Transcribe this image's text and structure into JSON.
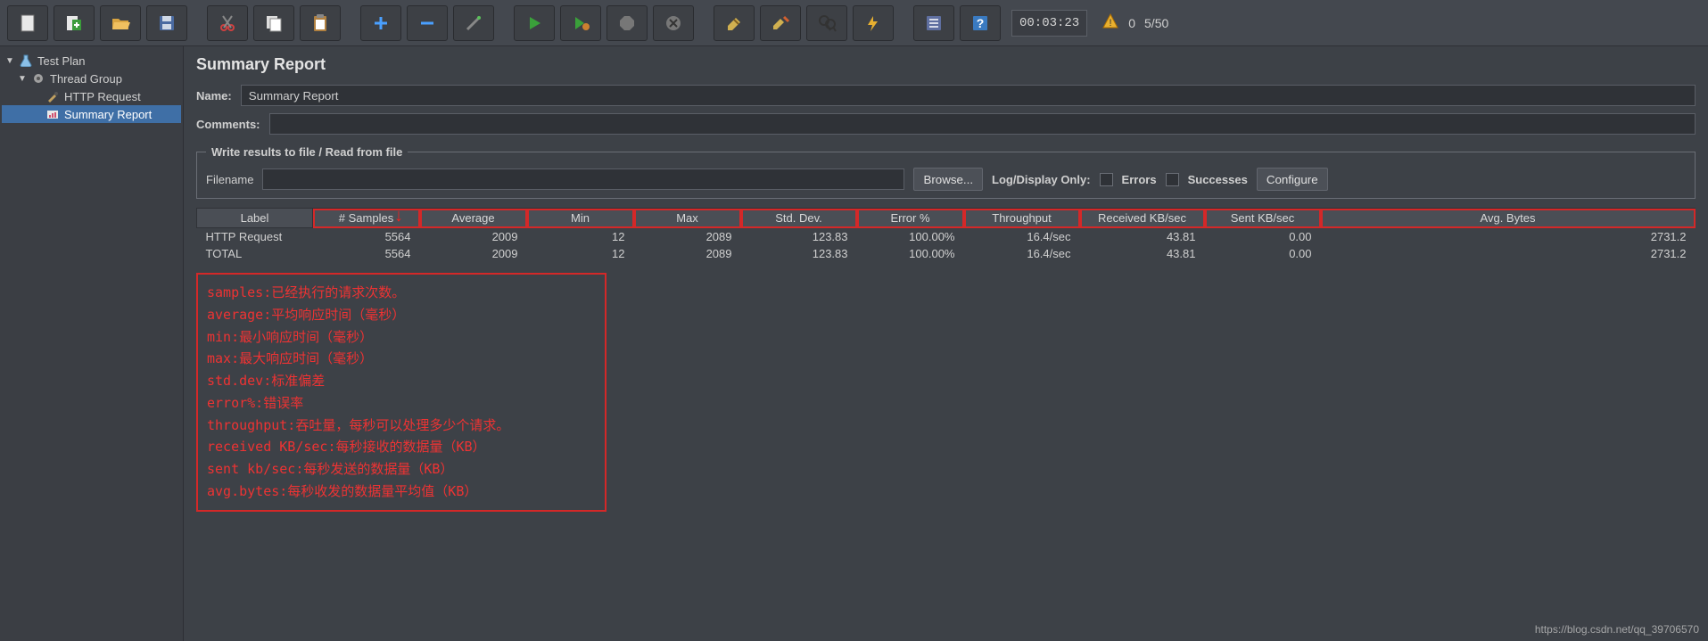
{
  "toolbar": {
    "timer": "00:03:23",
    "warn_count": "0",
    "thread_count": "5/50",
    "icons": [
      "file-new",
      "file-new-template",
      "file-open",
      "file-save",
      "",
      "cut",
      "copy",
      "paste",
      "",
      "plus",
      "minus",
      "wand",
      "",
      "run",
      "run-no-timers",
      "stop",
      "stop-all",
      "shutdown",
      "",
      "toggle-1",
      "toggle-2",
      "search",
      "clear",
      "",
      "function-helper",
      "help"
    ]
  },
  "tree": {
    "items": [
      {
        "label": "Test Plan",
        "icon": "beaker",
        "depth": 0,
        "expanded": true
      },
      {
        "label": "Thread Group",
        "icon": "gear",
        "depth": 1,
        "expanded": true
      },
      {
        "label": "HTTP Request",
        "icon": "dropper",
        "depth": 2
      },
      {
        "label": "Summary Report",
        "icon": "report",
        "depth": 2,
        "selected": true
      }
    ]
  },
  "panel": {
    "title": "Summary Report",
    "name_label": "Name:",
    "name_value": "Summary Report",
    "comments_label": "Comments:",
    "fieldset_legend": "Write results to file / Read from file",
    "filename_label": "Filename",
    "browse_label": "Browse...",
    "logdisplay_label": "Log/Display Only:",
    "errors_label": "Errors",
    "successes_label": "Successes",
    "configure_label": "Configure"
  },
  "table": {
    "columns": [
      "Label",
      "# Samples",
      "Average",
      "Min",
      "Max",
      "Std. Dev.",
      "Error %",
      "Throughput",
      "Received KB/sec",
      "Sent KB/sec",
      "Avg. Bytes"
    ],
    "rows": [
      {
        "label": "HTTP Request",
        "samples": "5564",
        "average": "2009",
        "min": "12",
        "max": "2089",
        "stddev": "123.83",
        "error": "100.00%",
        "throughput": "16.4/sec",
        "recv": "43.81",
        "sent": "0.00",
        "avgbytes": "2731.2"
      },
      {
        "label": "TOTAL",
        "samples": "5564",
        "average": "2009",
        "min": "12",
        "max": "2089",
        "stddev": "123.83",
        "error": "100.00%",
        "throughput": "16.4/sec",
        "recv": "43.81",
        "sent": "0.00",
        "avgbytes": "2731.2"
      }
    ]
  },
  "annotation": {
    "lines": [
      "samples:已经执行的请求次数。",
      "average:平均响应时间（毫秒）",
      "min:最小响应时间（毫秒）",
      "max:最大响应时间（毫秒）",
      "std.dev:标准偏差",
      "error%:错误率",
      "throughput:吞吐量，每秒可以处理多少个请求。",
      "received KB/sec:每秒接收的数据量（KB）",
      "sent kb/sec:每秒发送的数据量（KB）",
      "avg.bytes:每秒收发的数据量平均值（KB）"
    ]
  },
  "watermark": "https://blog.csdn.net/qq_39706570"
}
